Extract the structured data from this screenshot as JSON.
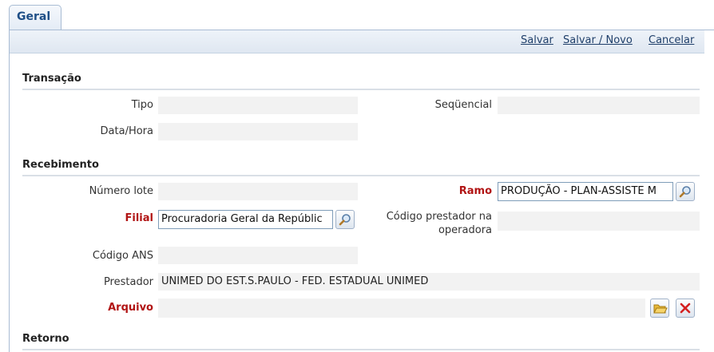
{
  "tab": {
    "label": "Geral"
  },
  "toolbar": {
    "save": "Salvar",
    "save_new": "Salvar / Novo",
    "cancel": "Cancelar"
  },
  "sections": {
    "transacao": "Transação",
    "recebimento": "Recebimento",
    "retorno": "Retorno"
  },
  "fields": {
    "tipo": {
      "label": "Tipo",
      "value": ""
    },
    "sequencial": {
      "label": "Seqüencial",
      "value": ""
    },
    "data_hora": {
      "label": "Data/Hora",
      "value": ""
    },
    "numero_lote": {
      "label": "Número lote",
      "value": ""
    },
    "ramo": {
      "label": "Ramo",
      "value": "PRODUÇÃO - PLAN-ASSISTE M"
    },
    "filial": {
      "label": "Filial",
      "value": "Procuradoria Geral da Repúblic"
    },
    "codigo_prestador": {
      "label_line1": "Código prestador na",
      "label_line2": "operadora",
      "value": ""
    },
    "codigo_ans": {
      "label": "Código ANS",
      "value": ""
    },
    "prestador": {
      "label": "Prestador",
      "value": "UNIMED DO EST.S.PAULO - FED. ESTADUAL UNIMED"
    },
    "arquivo": {
      "label": "Arquivo",
      "value": ""
    }
  },
  "icons": {
    "search": "magnifier-icon",
    "folder": "folder-open-icon",
    "delete": "red-x-icon"
  },
  "colors": {
    "tab_text": "#1f4f87",
    "required_label": "#b11414",
    "link": "#1f3f6a",
    "field_bg": "#f2f2f2"
  }
}
